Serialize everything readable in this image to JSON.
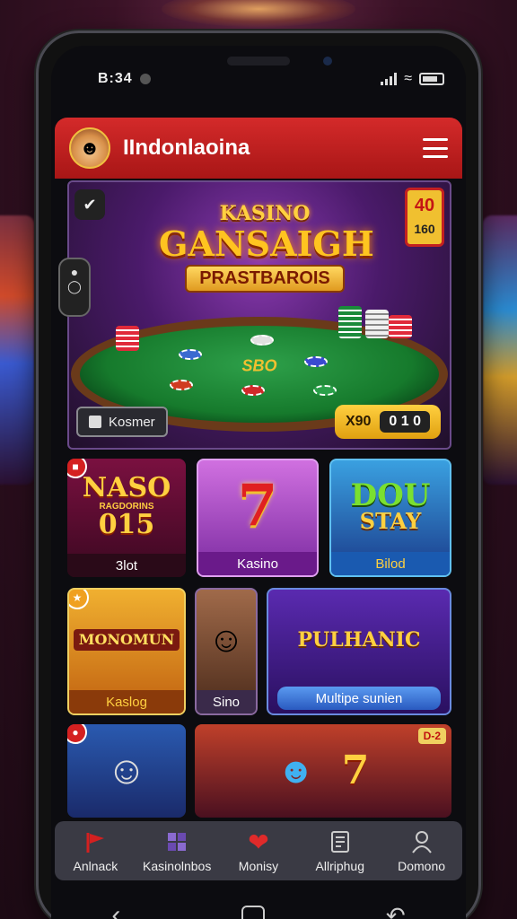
{
  "status_bar": {
    "time": "B:34"
  },
  "app": {
    "brand": "IIndonlaoina"
  },
  "banner": {
    "title_line1": "KASINO",
    "title_line2": "GANSAIGH",
    "title_line3": "PRASTBAROIS",
    "table_text": "SBO",
    "badge_top": "40",
    "badge_bottom": "160",
    "member_button": "Kosmer",
    "counter_label": "X90",
    "counter_value": "0 1 0"
  },
  "games_row1": [
    {
      "title": "NASO",
      "subtitle": "RAGDORINS",
      "number": "015",
      "caption": "3lot"
    },
    {
      "title": "7",
      "caption": "Kasino"
    },
    {
      "title": "DOU",
      "subtitle": "STAY",
      "caption": "Bilod"
    }
  ],
  "games_row2": [
    {
      "title": "MONOMUN",
      "caption": "Kaslog"
    },
    {
      "caption": "Sino"
    },
    {
      "title": "PULHANIC",
      "caption": "Multipe sunien"
    }
  ],
  "games_row3": [
    {
      "badge": "D-2"
    }
  ],
  "bottom_nav": [
    {
      "label": "Anlnack",
      "icon": "flag-icon"
    },
    {
      "label": "Kasinolnbos",
      "icon": "grid-icon"
    },
    {
      "label": "Monisy",
      "icon": "heart-icon"
    },
    {
      "label": "Allriphug",
      "icon": "document-icon"
    },
    {
      "label": "Domono",
      "icon": "user-icon"
    }
  ],
  "colors": {
    "header_red": "#c41e1e",
    "accent_gold": "#f0c030",
    "felt_green": "#1a8a3a"
  }
}
